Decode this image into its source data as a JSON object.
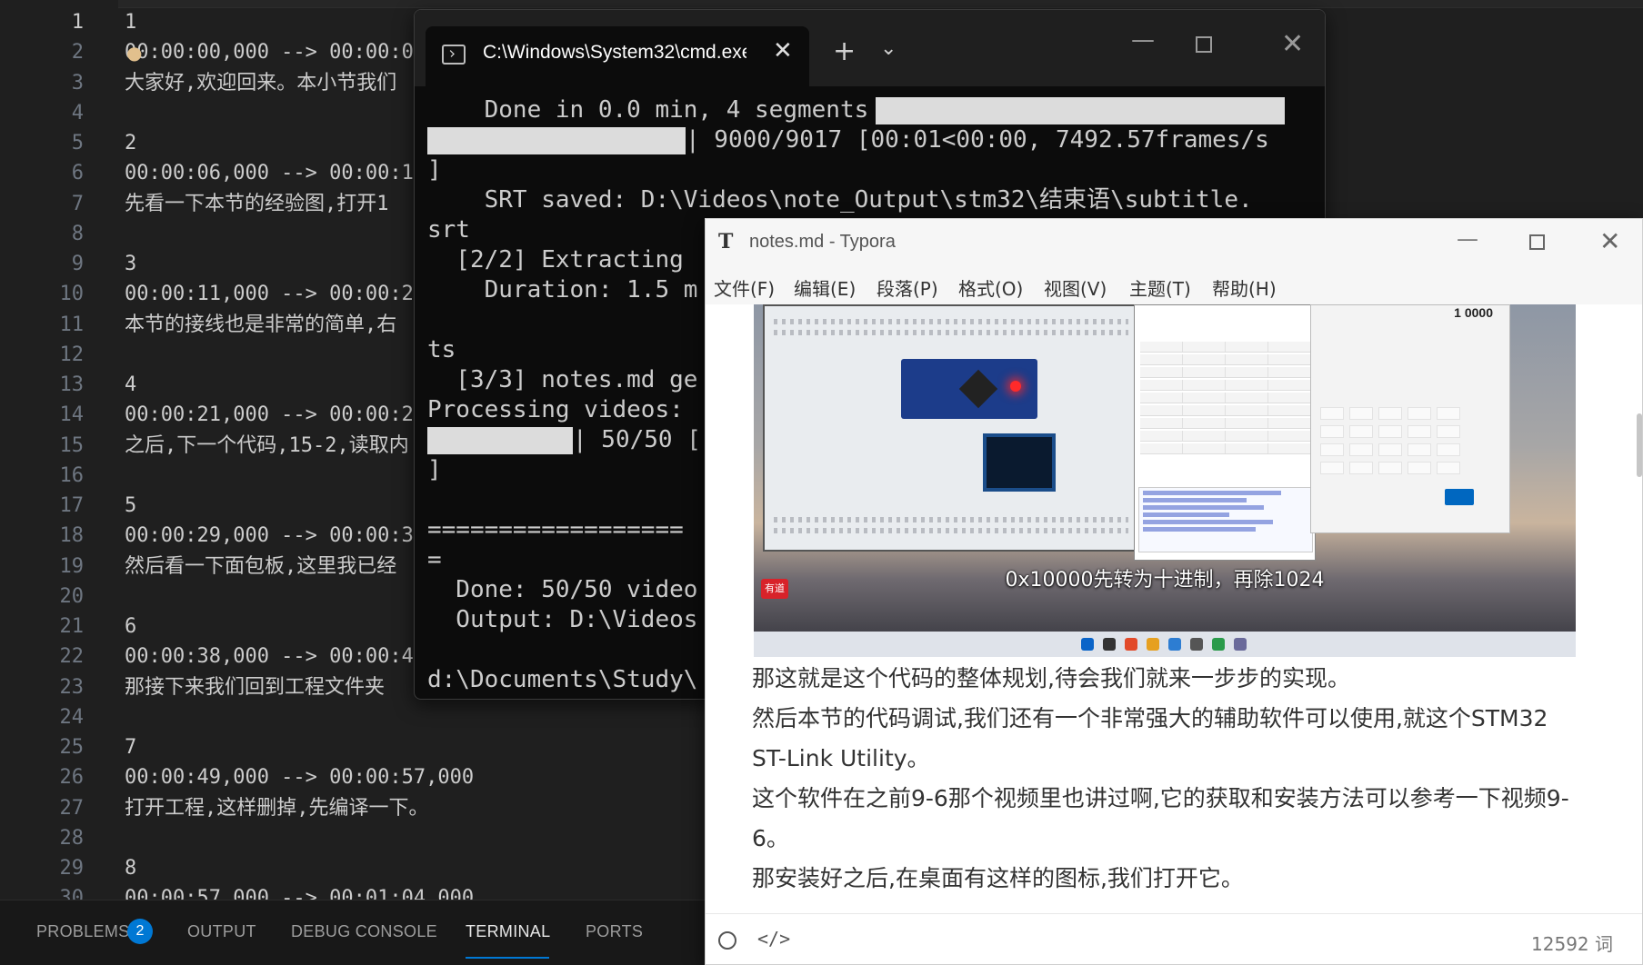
{
  "editor": {
    "line_numbers": [
      "1",
      "2",
      "3",
      "4",
      "5",
      "6",
      "7",
      "8",
      "9",
      "10",
      "11",
      "12",
      "13",
      "14",
      "15",
      "16",
      "17",
      "18",
      "19",
      "20",
      "21",
      "22",
      "23",
      "24",
      "25",
      "26",
      "27",
      "28",
      "29",
      "30"
    ],
    "lines": [
      "1",
      "00:00:00,000 --> 00:00:0",
      "大家好,欢迎回来。本小节我们",
      "",
      "2",
      "00:00:06,000 --> 00:00:1",
      "先看一下本节的经验图,打开1",
      "",
      "3",
      "00:00:11,000 --> 00:00:2",
      "本节的接线也是非常的简单,右",
      "",
      "4",
      "00:00:21,000 --> 00:00:2",
      "之后,下一个代码,15-2,读取内",
      "",
      "5",
      "00:00:29,000 --> 00:00:3",
      "然后看一下面包板,这里我已经",
      "",
      "6",
      "00:00:38,000 --> 00:00:4",
      "那接下来我们回到工程文件夹",
      "",
      "7",
      "00:00:49,000 --> 00:00:57,000",
      "打开工程,这样删掉,先编译一下。",
      "",
      "8",
      "00:00:57,000 --> 00:01:04,000"
    ]
  },
  "panel": {
    "tabs": [
      "PROBLEMS",
      "OUTPUT",
      "DEBUG CONSOLE",
      "TERMINAL",
      "PORTS"
    ],
    "problems_count": "2",
    "active_tab": "TERMINAL",
    "accent_color": "#0078d4"
  },
  "cmd": {
    "tab_title": "C:\\Windows\\System32\\cmd.exe",
    "close_glyph": "✕",
    "new_tab_glyph": "+",
    "dropdown_glyph": "⌄",
    "minimize_glyph": "—",
    "close_window_glyph": "✕",
    "lines": {
      "l1": "    Done in 0.0 min, 4 segments",
      "l2_suffix": "| 9000/9017 [00:01<00:00, 7492.57frames/s",
      "l3": "]",
      "l4": "    SRT saved: D:\\Videos\\note_Output\\stm32\\结束语\\subtitle.",
      "l5": "srt",
      "l6": "  [2/2] Extracting",
      "l7": "    Duration: 1.5 m",
      "l8": "",
      "l9": "ts",
      "l10": "  [3/3] notes.md ge",
      "l11": "Processing videos:",
      "l12_suffix": "| 50/50 [",
      "l13": "]",
      "l14": "",
      "l15": "==================",
      "l16": "=",
      "l17": "  Done: 50/50 video",
      "l18": "  Output: D:\\Videos",
      "l19": "",
      "l20": "d:\\Documents\\Study\\"
    }
  },
  "typora": {
    "logo": "T",
    "title": "notes.md - Typora",
    "minimize_glyph": "—",
    "close_glyph": "✕",
    "menu": [
      "文件(F)",
      "编辑(E)",
      "段落(P)",
      "格式(O)",
      "视图(V)",
      "主题(T)",
      "帮助(H)"
    ],
    "image_caption": "0x10000先转为十进制，再除1024",
    "image_logo": "有道",
    "calc_display": "1 0000",
    "paragraphs": [
      "那这就是这个代码的整体规划,待会我们就来一步步的实现。",
      "然后本节的代码调试,我们还有一个非常强大的辅助软件可以使用,就这个STM32 ST-Link Utility。",
      "这个软件在之前9-6那个视频里也讲过啊,它的获取和安装方法可以参考一下视频9-6。",
      "那安装好之后,在桌面有这样的图标,我们打开它。"
    ],
    "source_icon": "</>",
    "word_count": "12592 词"
  }
}
